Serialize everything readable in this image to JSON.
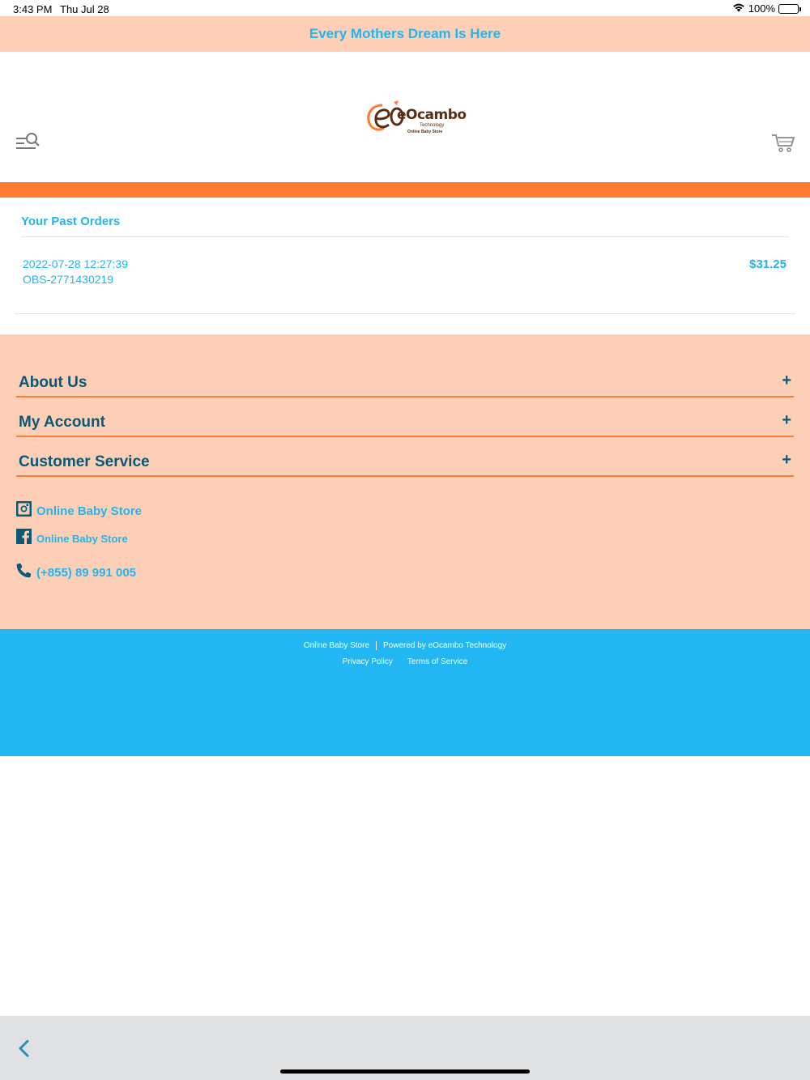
{
  "status_bar": {
    "time": "3:43 PM",
    "date": "Thu Jul 28",
    "battery": "100%",
    "icons": [
      "wifi-icon",
      "battery-icon"
    ]
  },
  "promo": {
    "text": "Every Mothers Dream Is Here"
  },
  "header": {
    "logo_main": "eOcambo",
    "logo_sub": "Technology",
    "logo_tag": "Online Baby Store",
    "icons": [
      "menu-search-icon",
      "cart-icon"
    ]
  },
  "orders": {
    "title": "Your Past Orders",
    "items": [
      {
        "date": "2022-07-28 12:27:39",
        "code": "OBS-2771430219",
        "total": "$31.25"
      }
    ]
  },
  "footer": {
    "sections": [
      {
        "label": "About Us",
        "toggle": "+"
      },
      {
        "label": "My Account",
        "toggle": "+"
      },
      {
        "label": "Customer Service",
        "toggle": "+"
      }
    ],
    "instagram": "Online Baby Store",
    "facebook": "Online Baby Store",
    "phone": "(+855) 89 991 005"
  },
  "bottom": {
    "store": "Online Baby Store",
    "powered": "Powered by eOcambo Technology",
    "privacy": "Privacy Policy",
    "terms": "Terms of Service"
  },
  "colors": {
    "accent_blue": "#22b6ee",
    "dark_blue": "#0a5877",
    "orange": "#ff7d33",
    "peach": "#fdcfb6"
  }
}
